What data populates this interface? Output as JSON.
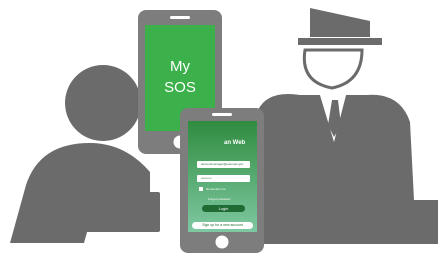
{
  "colors": {
    "figure": "#6b6b6b",
    "phone_frame": "#7d7d7d",
    "screen_green": "#3cb04a",
    "screen_gradient_top": "#2f8c3f",
    "screen_gradient_bottom": "#7fc8a2",
    "button_green": "#1f6b33",
    "background": "#ffffff"
  },
  "icons": {
    "traveler": "person-silhouette-icon",
    "officer": "border-officer-icon",
    "desk": "counter-desk-icon"
  },
  "phone_back": {
    "app_name_line1": "My",
    "app_name_line2": "SOS"
  },
  "phone_front": {
    "header": "an Web",
    "field_1": "accountmanager@example.gov",
    "field_2": "••••••••••",
    "remember": "Remember me",
    "forgot": "Forgot password",
    "login_button": "Login",
    "signup_button": "Sign up for a new account"
  }
}
